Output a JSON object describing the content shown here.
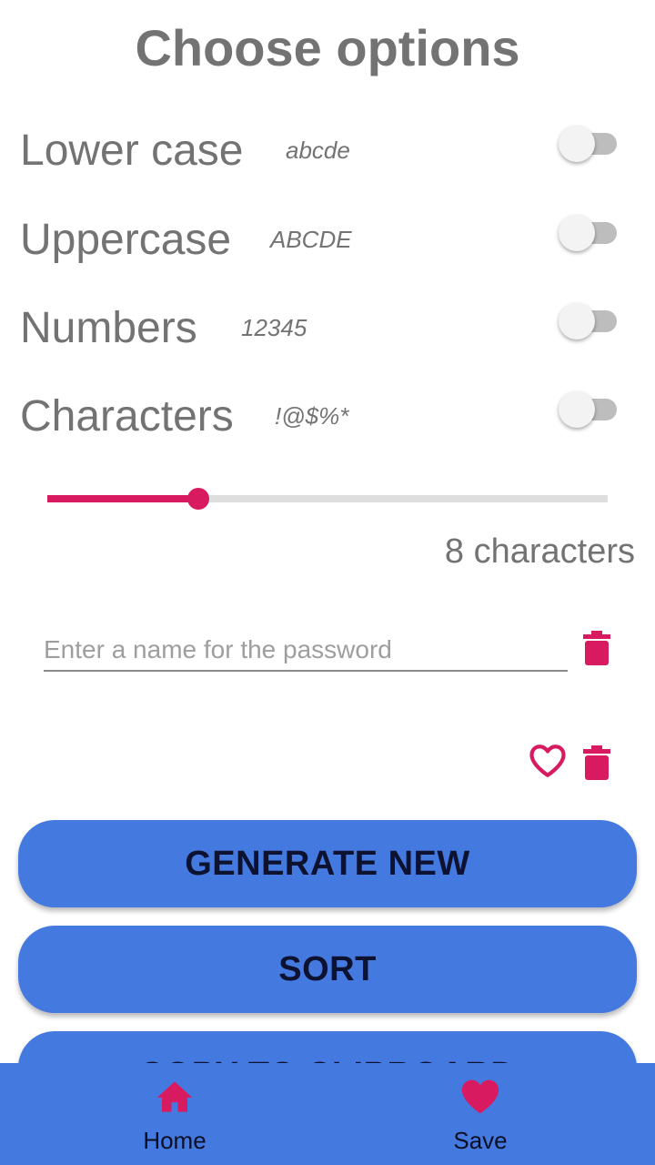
{
  "title": "Choose options",
  "options": [
    {
      "label": "Lower case",
      "sample": "abcde",
      "enabled": false
    },
    {
      "label": "Uppercase",
      "sample": "ABCDE",
      "enabled": false
    },
    {
      "label": "Numbers",
      "sample": "12345",
      "enabled": false
    },
    {
      "label": "Characters",
      "sample": "!@$%*",
      "enabled": false
    }
  ],
  "length": {
    "value_fraction": 0.27,
    "label": "8 characters"
  },
  "name_input": {
    "placeholder": "Enter a name for the password",
    "value": ""
  },
  "buttons": {
    "generate": "GENERATE NEW",
    "sort": "SORT",
    "clipboard": "COPY TO CLIPBOARD"
  },
  "nav": {
    "home": "Home",
    "save": "Save"
  },
  "colors": {
    "accent": "#d81b60",
    "primary": "#4479e0",
    "text": "#737373"
  },
  "icons": {
    "delete": "trash-icon",
    "favorite": "heart-outline-icon",
    "home": "home-icon",
    "save": "heart-icon"
  }
}
